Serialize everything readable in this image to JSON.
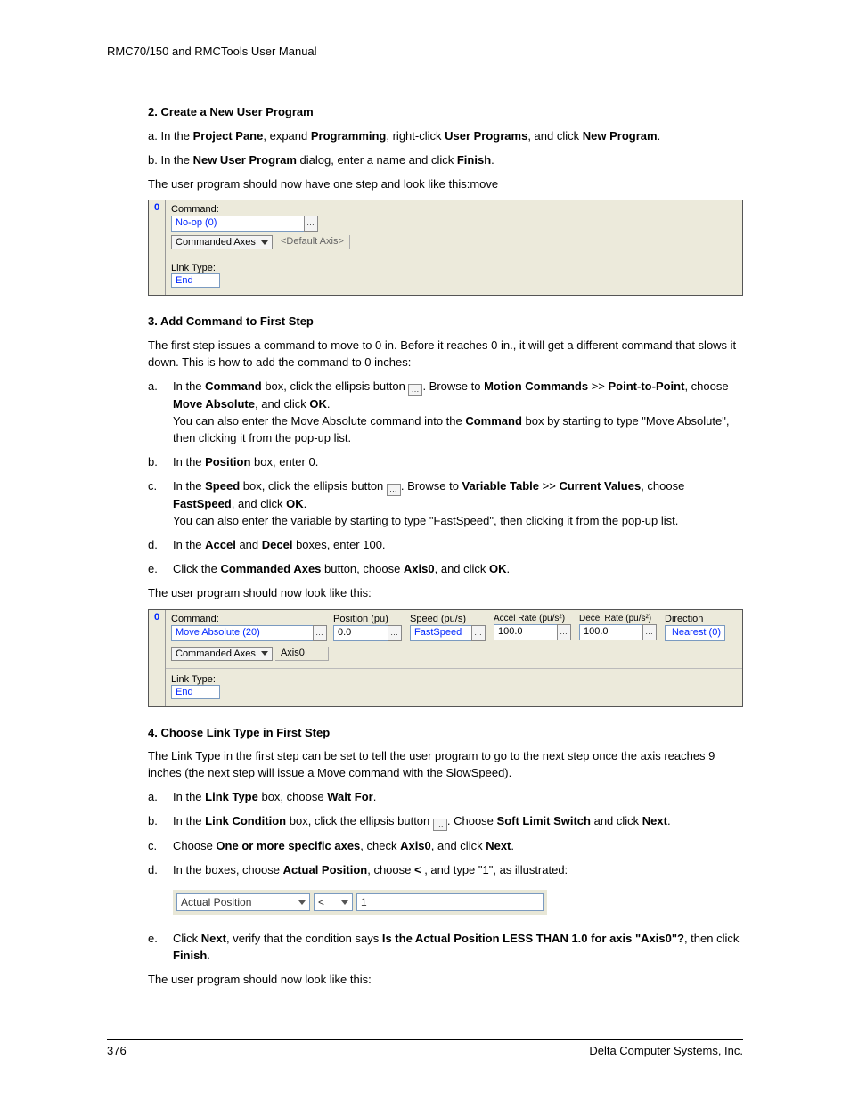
{
  "runhead": "RMC70/150 and RMCTools User Manual",
  "sec2": {
    "title": "2. Create a New User Program",
    "a_pre": "a.   In the ",
    "a_b1": "Project Pane",
    "a_mid1": ", expand ",
    "a_b2": "Programming",
    "a_mid2": ", right-click ",
    "a_b3": "User Programs",
    "a_mid3": ", and click ",
    "a_b4": "New Program",
    "a_post": ".",
    "b_pre": "b.   In the ",
    "b_b1": "New User Program",
    "b_mid": "  dialog, enter a name and click ",
    "b_b2": "Finish",
    "b_post": ".",
    "line": "The user program should now have one step and look like this:move"
  },
  "shot1": {
    "stepnum": "0",
    "command_label": "Command:",
    "command_value": "No-op (0)",
    "cmdaxes_label": "Commanded Axes",
    "default_axis": "<Default Axis>",
    "linktype_label": "Link Type:",
    "linktype_value": "End"
  },
  "sec3": {
    "title": "3. Add Command to First Step",
    "intro": "The first step issues a command to move to 0 in. Before it reaches 0 in., it will get a different command that slows it down. This is how to add the command to 0 inches:",
    "a": {
      "marker": "a.",
      "t1": "In the ",
      "b1": "Command",
      "t2": " box, click the ellipsis button ",
      "t3": ". Browse to ",
      "b2": "Motion Commands",
      "t4": " >> ",
      "b3": "Point-to-Point",
      "t5": ", choose ",
      "b4": "Move Absolute",
      "t6": ", and click ",
      "b5": "OK",
      "t7": ".",
      "line2a": "You can also enter the Move Absolute command into the ",
      "line2b": "Command",
      "line2c": " box by starting to type \"Move Absolute\", then clicking it from the pop-up list."
    },
    "b": {
      "marker": "b.",
      "t1": "In the ",
      "b1": "Position",
      "t2": " box, enter 0."
    },
    "c": {
      "marker": "c.",
      "t1": "In the ",
      "b1": "Speed",
      "t2": "  box, click the ellipsis button ",
      "t3": ". Browse to ",
      "b2": "Variable Table",
      "t4": " >> ",
      "b3": "Current Values",
      "t5": ", choose ",
      "b4": "FastSpeed",
      "t6": ", and click ",
      "b5": "OK",
      "t7": ".",
      "line2": "You can also enter the variable by starting to type \"FastSpeed\", then clicking it from the pop-up list."
    },
    "d": {
      "marker": "d.",
      "t1": "In the ",
      "b1": "Accel",
      "t2": " and ",
      "b2": "Decel",
      "t3": " boxes, enter 100."
    },
    "e": {
      "marker": "e.",
      "t1": "Click the ",
      "b1": "Commanded Axes",
      "t2": " button, choose ",
      "b2": "Axis0",
      "t3": ", and click ",
      "b3": "OK",
      "t4": "."
    },
    "outro": "The user program should now look like this:"
  },
  "shot2": {
    "stepnum": "0",
    "cols": {
      "command": "Command:",
      "position": "Position (pu)",
      "speed": "Speed (pu/s)",
      "accel": "Accel Rate (pu/s²)",
      "decel": "Decel Rate (pu/s²)",
      "direction": "Direction"
    },
    "vals": {
      "command": "Move Absolute (20)",
      "position": "0.0",
      "speed": "FastSpeed",
      "accel": "100.0",
      "decel": "100.0",
      "direction": "Nearest (0)"
    },
    "cmdaxes_label": "Commanded Axes",
    "axis": "Axis0",
    "linktype_label": "Link Type:",
    "linktype_value": "End"
  },
  "sec4": {
    "title": "4. Choose Link Type in First Step",
    "intro": "The Link Type in the first step can be set to tell the user program to go to the next step once the axis reaches 9 inches (the next step will issue a Move command with the SlowSpeed).",
    "a": {
      "marker": "a.",
      "t1": "In the  ",
      "b1": "Link Type",
      "t2": "  box, choose ",
      "b2": "Wait For",
      "t3": "."
    },
    "b": {
      "marker": "b.",
      "t1": "In the ",
      "b1": "Link Condition",
      "t2": " box, click the ellipsis button ",
      "t3": ". Choose ",
      "b2": "Soft Limit Switch",
      "t4": " and click ",
      "b3": "Next",
      "t5": "."
    },
    "c": {
      "marker": "c.",
      "t1": "Choose ",
      "b1": "One or more specific axes",
      "t2": ", check ",
      "b2": "Axis0",
      "t3": ", and click ",
      "b3": "Next",
      "t4": "."
    },
    "d": {
      "marker": "d.",
      "t1": "In the boxes, choose ",
      "b1": "Actual Position",
      "t2": ", choose ",
      "b2": "<",
      "t3": " , and type \"1\", as illustrated:"
    },
    "cond": {
      "field": "Actual Position",
      "op": "<",
      "value": "1"
    },
    "e": {
      "marker": "e.",
      "t1": "Click ",
      "b1": "Next",
      "t2": ", verify that the condition says ",
      "b2": "Is the Actual Position LESS THAN 1.0 for axis \"Axis0\"?",
      "t3": ", then click ",
      "b3": "Finish",
      "t4": "."
    },
    "outro": "The user program should now look like this:"
  },
  "footer": {
    "page": "376",
    "company": "Delta Computer Systems, Inc."
  }
}
